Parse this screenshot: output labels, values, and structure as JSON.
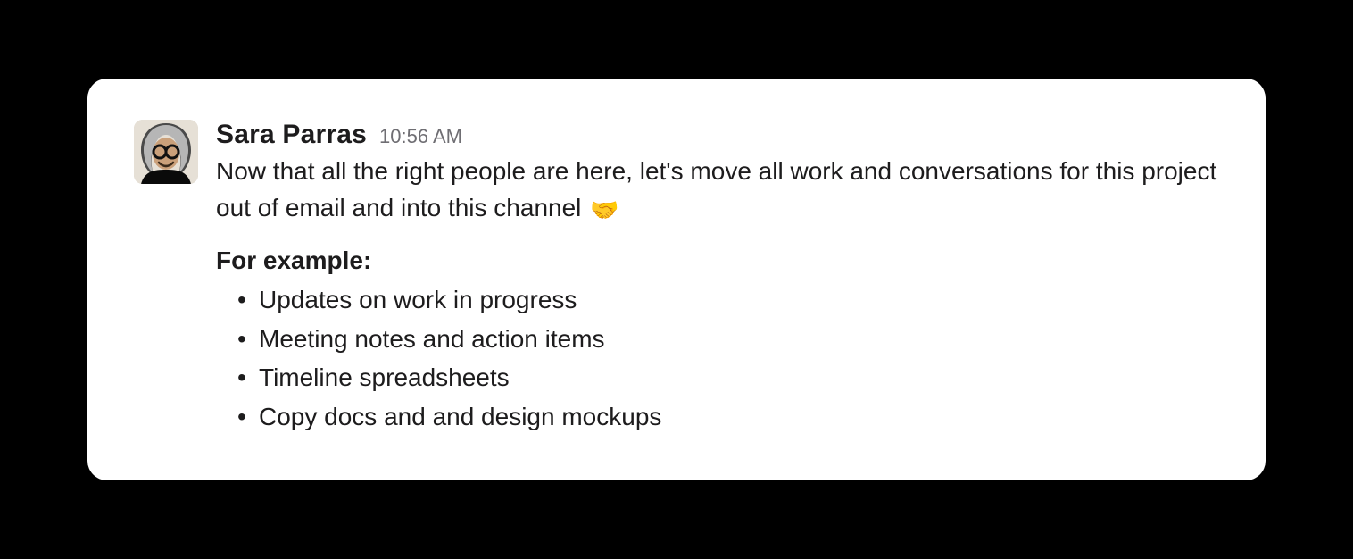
{
  "message": {
    "author": "Sara Parras",
    "timestamp": "10:56 AM",
    "body_text": "Now that all the right people are here, let's move all work and conversations for this project out of email and into this channel ",
    "emoji": "🤝",
    "example_label": "For example:",
    "example_items": [
      "Updates on work in progress",
      "Meeting notes and action items",
      "Timeline spreadsheets",
      "Copy docs and and design mockups"
    ]
  }
}
